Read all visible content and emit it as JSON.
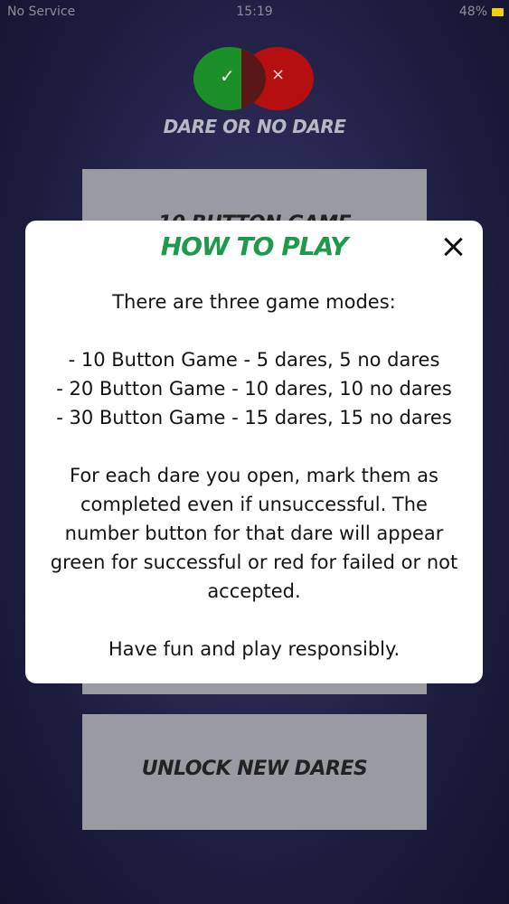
{
  "status_bar": {
    "carrier": "No Service",
    "time": "15:19",
    "battery": "48%"
  },
  "logo": {
    "check_symbol": "✓",
    "cross_symbol": "×",
    "title": "DARE OR NO DARE"
  },
  "menu": {
    "button_10": "10 BUTTON GAME",
    "unlock": "UNLOCK NEW DARES"
  },
  "modal": {
    "title": "HOW TO PLAY",
    "intro": "There are three game modes:",
    "modes": [
      "- 10 Button Game - 5 dares, 5 no dares",
      "- 20 Button Game - 10 dares, 10 no dares",
      "- 30 Button Game - 15 dares, 15 no dares"
    ],
    "instructions": [
      "For each dare you open, mark them as",
      "completed even if unsuccessful. The",
      "number button for that dare will appear",
      "green for successful or red for failed or not",
      "accepted."
    ],
    "closing": "Have fun and play responsibly."
  },
  "colors": {
    "accent_green": "#1f9a4d",
    "logo_green": "#1b8f2a",
    "logo_red": "#b50f0f",
    "button_gray": "#9a9aa3",
    "battery_yellow": "#f3d100"
  }
}
